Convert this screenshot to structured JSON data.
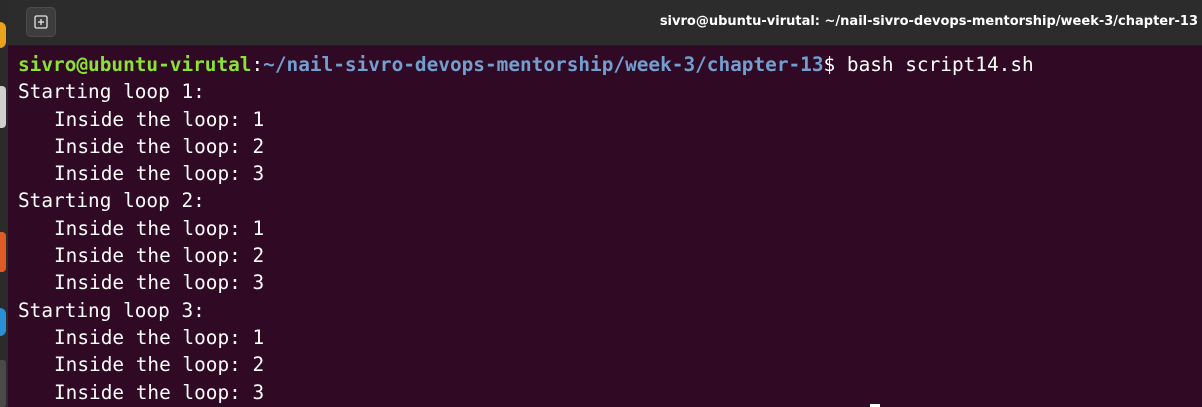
{
  "window": {
    "title": "sivro@ubuntu-virutal: ~/nail-sivro-devops-mentorship/week-3/chapter-13",
    "new_tab_icon": "new-tab-icon"
  },
  "prompt": {
    "user_host": "sivro@ubuntu-virutal",
    "colon": ":",
    "path": "~/nail-sivro-devops-mentorship/week-3/chapter-13",
    "symbol": "$ ",
    "command": "bash script14.sh"
  },
  "output": [
    {
      "text": "Starting loop 1:",
      "indent": false
    },
    {
      "text": "Inside the loop: 1",
      "indent": true
    },
    {
      "text": "Inside the loop: 2",
      "indent": true
    },
    {
      "text": "Inside the loop: 3",
      "indent": true
    },
    {
      "text": "Starting loop 2:",
      "indent": false
    },
    {
      "text": "Inside the loop: 1",
      "indent": true
    },
    {
      "text": "Inside the loop: 2",
      "indent": true
    },
    {
      "text": "Inside the loop: 3",
      "indent": true
    },
    {
      "text": "Starting loop 3:",
      "indent": false
    },
    {
      "text": "Inside the loop: 1",
      "indent": true
    },
    {
      "text": "Inside the loop: 2",
      "indent": true
    },
    {
      "text": "Inside the loop: 3",
      "indent": true
    }
  ],
  "colors": {
    "background": "#300a24",
    "prompt_user": "#8ae234",
    "prompt_path": "#729fcf",
    "titlebar": "#2c2c2c"
  }
}
